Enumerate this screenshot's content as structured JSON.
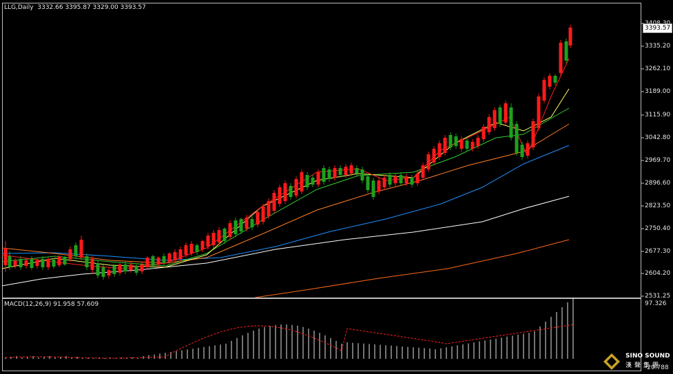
{
  "header": {
    "symbol_label": "LLG,Daily",
    "ohlc": "3332.66 3395.87 3329.00 3393.57"
  },
  "macd": {
    "label": "MACD(12,26,9) 91.958 57.609",
    "axis_top": "97.326",
    "axis_bottom": "-20.788"
  },
  "price_axis": [
    "3408.30",
    "3335.20",
    "3262.10",
    "3189.00",
    "3115.90",
    "3042.80",
    "2969.70",
    "2896.60",
    "2823.50",
    "2750.40",
    "2677.30",
    "2604.20",
    "2531.25"
  ],
  "current_price": "3393.57",
  "logo": {
    "brand": "SINO SOUND",
    "cn": "漢聲集團"
  },
  "colors": {
    "bull": "#1ea01e",
    "bear": "#ff1a1a",
    "ma5": "#ff2020",
    "ma10": "#ffff66",
    "ma20": "#33cc33",
    "ma30": "#ff7f27",
    "ma60": "#1e90ff",
    "ma120": "#ffffff",
    "ma250": "#ff6a1a"
  }
}
